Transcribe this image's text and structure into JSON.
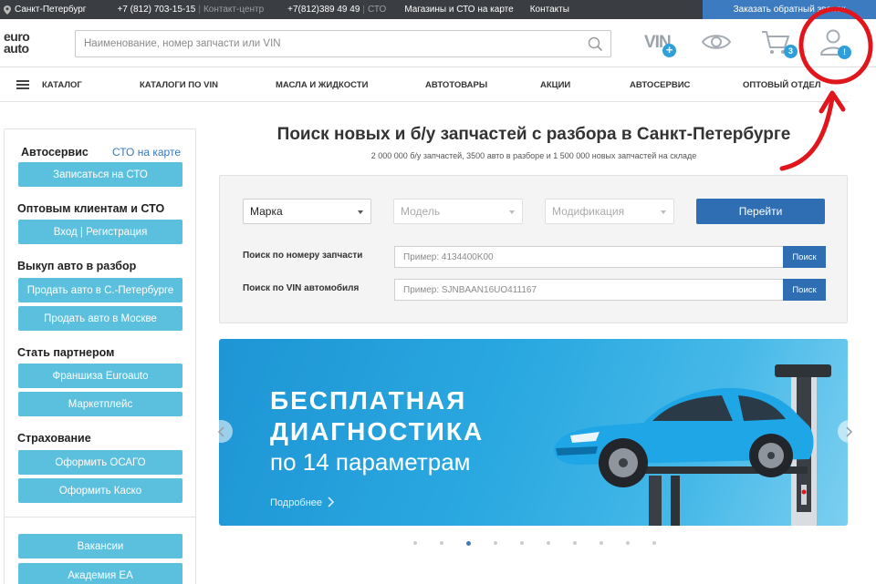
{
  "topbar": {
    "city": "Санкт-Петербург",
    "phone1": "+7 (812) 703-15-15",
    "phone1_note": "Контакт-центр",
    "phone2": "+7(812)389 49 49",
    "phone2_note": "СТО",
    "stores_link": "Магазины и СТО на карте",
    "contacts_link": "Контакты",
    "callback_button": "Заказать обратный звонок"
  },
  "header": {
    "logo_line1": "euro",
    "logo_line2": "auto",
    "search_placeholder": "Наименование, номер запчасти или VIN",
    "vin_label": "VIN",
    "vin_plus": "+",
    "cart_count": "3",
    "account_alert": "!"
  },
  "nav": {
    "items": [
      "Каталог",
      "Каталоги по VIN",
      "Масла и жидкости",
      "Автотовары",
      "Акции",
      "Автосервис",
      "Оптовый отдел"
    ]
  },
  "sidebar": {
    "sections": [
      {
        "title": "Автосервис",
        "link": "СТО на карте",
        "buttons": [
          "Записаться на СТО"
        ]
      },
      {
        "title": "Оптовым клиентам и СТО",
        "buttons": [
          "Вход | Регистрация"
        ]
      },
      {
        "title": "Выкуп авто в разбор",
        "buttons": [
          "Продать авто в С.-Петербурге",
          "Продать авто в Москве"
        ]
      },
      {
        "title": "Стать партнером",
        "buttons": [
          "Франшиза Euroauto",
          "Маркетплейс"
        ]
      },
      {
        "title": "Страхование",
        "buttons": [
          "Оформить ОСАГО",
          "Оформить Каско"
        ]
      },
      {
        "buttons": [
          "Вакансии",
          "Академия EA"
        ]
      }
    ]
  },
  "main": {
    "title": "Поиск новых и б/у запчастей с разбора в Санкт-Петербурге",
    "subtitle": "2 000 000 б/у запчастей, 3500 авто в разборе и 1 500 000 новых запчастей на складе",
    "selects": [
      "Марка",
      "Модель",
      "Модификация"
    ],
    "go_button": "Перейти",
    "part_search_label": "Поиск по номеру запчасти",
    "part_search_placeholder": "Пример: 4134400K00",
    "vin_search_label": "Поиск по VIN автомобиля",
    "vin_search_placeholder": "Пример: SJNBAAN16UO411167",
    "search_button": "Поиск"
  },
  "banner": {
    "line1": "БЕСПЛАТНАЯ",
    "line2": "ДИАГНОСТИКА",
    "line3": "по 14 параметрам",
    "more_link": "Подробнее",
    "dots_total": 10,
    "active_dot": 3
  },
  "colors": {
    "accent": "#5bc0de",
    "primary": "#2f6eb2",
    "topbar": "#3a3d42",
    "annotation": "#e0161c"
  }
}
